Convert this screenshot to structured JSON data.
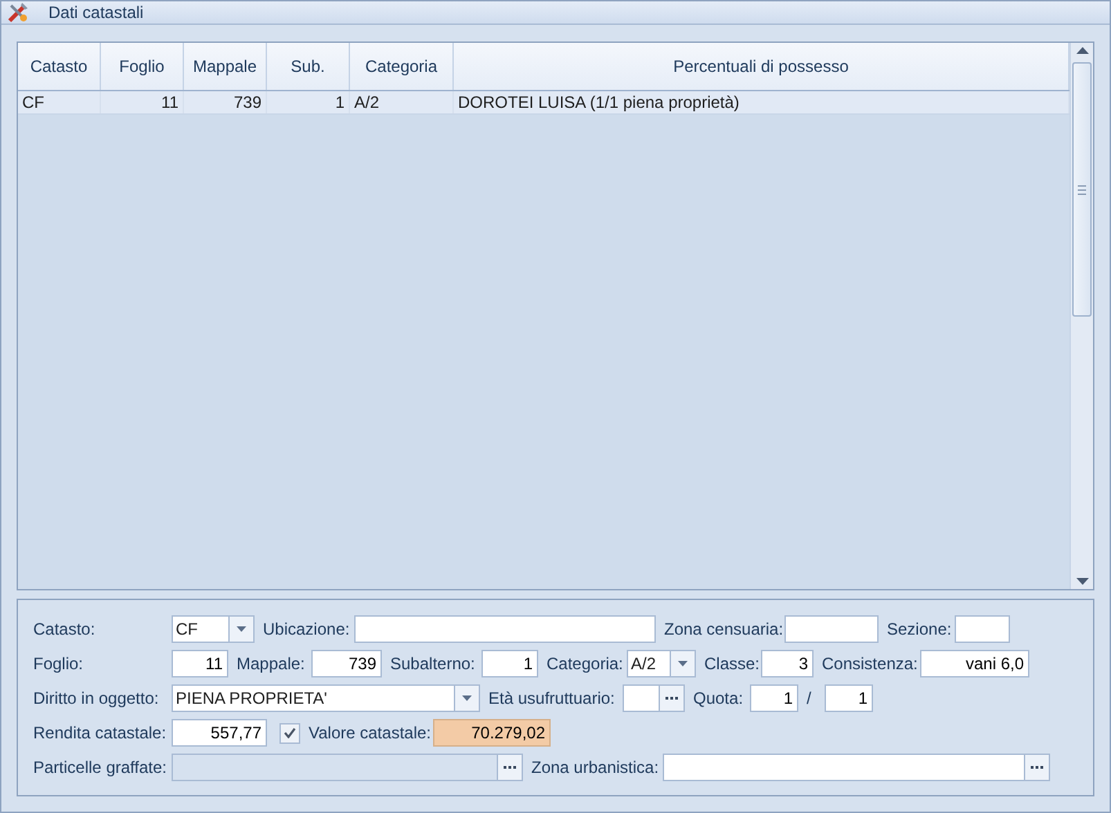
{
  "window": {
    "title": "Dati catastali"
  },
  "table": {
    "columns": [
      "Catasto",
      "Foglio",
      "Mappale",
      "Sub.",
      "Categoria",
      "Percentuali di possesso"
    ],
    "rows": [
      {
        "selected": true,
        "cells": [
          "CF",
          "11",
          "739",
          "1",
          "A/2",
          "DOROTEI LUISA (1/1 piena proprietà)"
        ]
      }
    ]
  },
  "form": {
    "lines": [
      {
        "fields": [
          {
            "label": "Catasto:",
            "kind": "combo",
            "value": "CF"
          },
          {
            "label": "Ubicazione:",
            "kind": "text"
          },
          {
            "label": "Zona censuaria:",
            "kind": "text"
          },
          {
            "label": "Sezione:",
            "kind": "text"
          }
        ]
      },
      {
        "fields": [
          {
            "label": "Foglio:",
            "kind": "number",
            "value": "11"
          },
          {
            "label": "Mappale:",
            "kind": "number",
            "value": "739"
          },
          {
            "label": "Subalterno:",
            "kind": "number",
            "value": "1"
          },
          {
            "label": "Categoria:",
            "kind": "combo",
            "value": "A/2"
          },
          {
            "label": "Classe:",
            "kind": "number",
            "value": "3"
          },
          {
            "label": "Consistenza:",
            "kind": "number",
            "value": "vani 6,0"
          }
        ]
      },
      {
        "fields": [
          {
            "label": "Diritto in oggetto:",
            "kind": "combo",
            "value": "PIENA PROPRIETA'"
          },
          {
            "label": "Età usufruttuario:",
            "kind": "picker",
            "disabled": false
          },
          {
            "label": "Quota:",
            "kind": "number",
            "value": "1"
          },
          {
            "label": "/",
            "kind": "number",
            "value": "1"
          }
        ]
      },
      {
        "fields": [
          {
            "label": "Rendita catastale:",
            "kind": "number",
            "value": "557,77"
          },
          {
            "kind": "check",
            "checked": true
          },
          {
            "label": "Valore catastale:",
            "kind": "number",
            "value": "70.279,02",
            "highlighted": true
          }
        ]
      },
      {
        "fields": [
          {
            "label": "Particelle graffate:",
            "kind": "picker",
            "disabled": true
          },
          {
            "label": "Zona urbanistica:",
            "kind": "picker",
            "disabled": false
          }
        ]
      }
    ]
  }
}
